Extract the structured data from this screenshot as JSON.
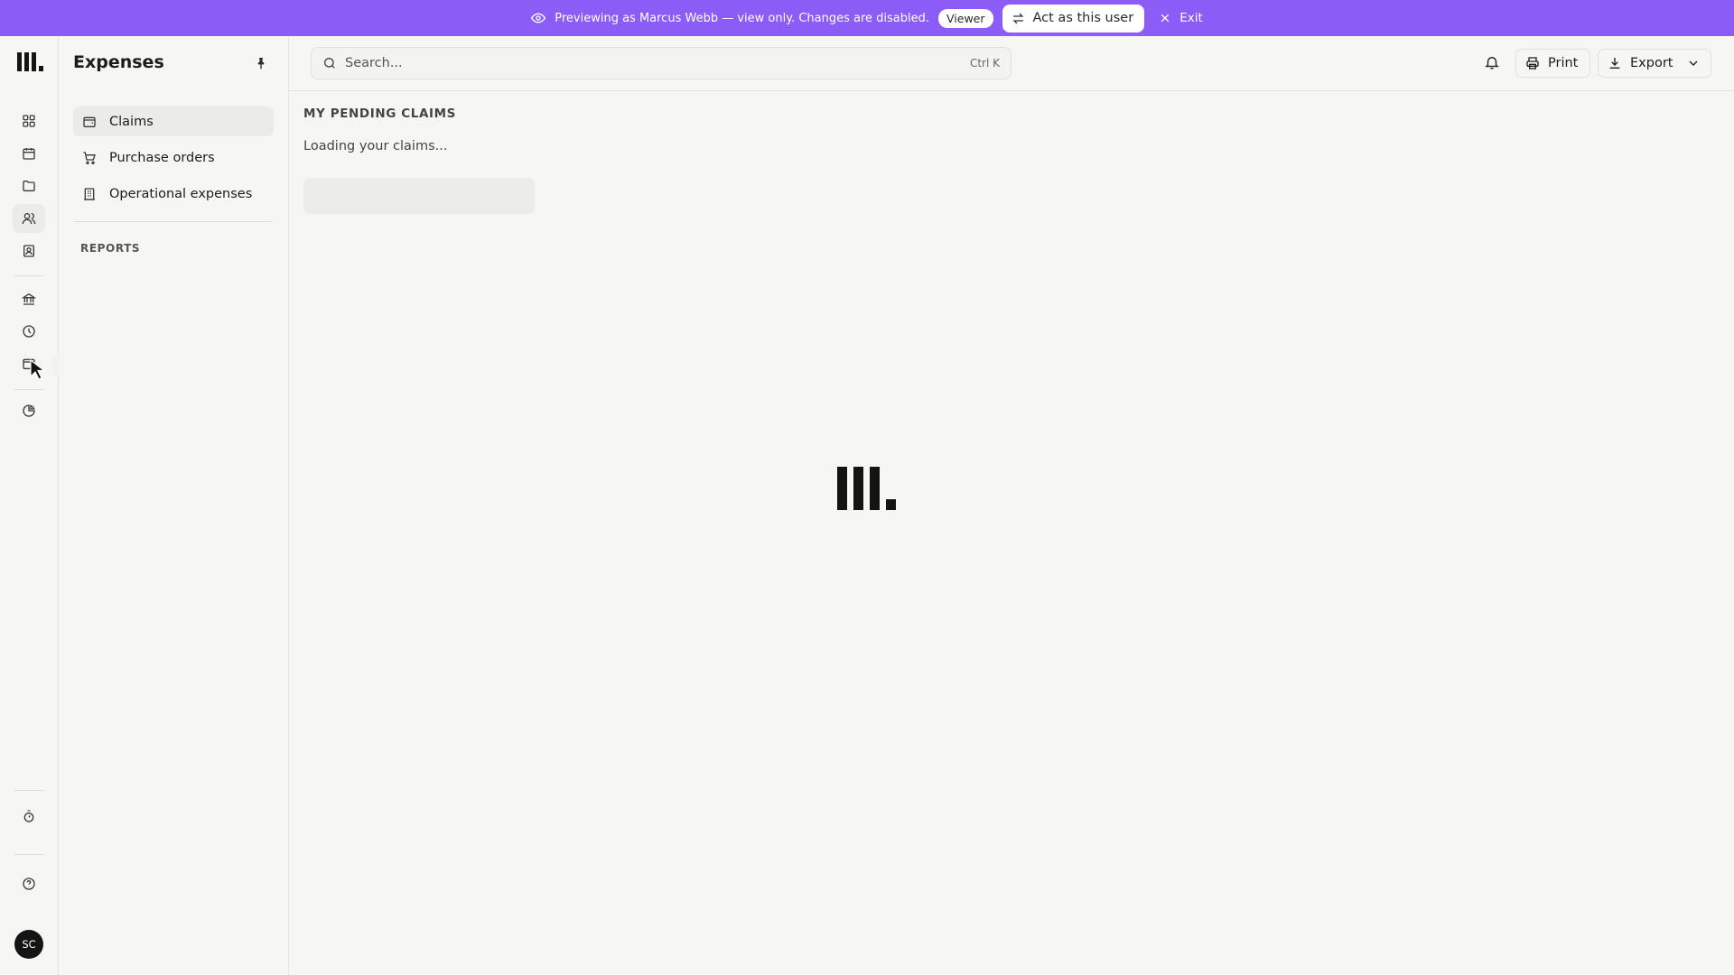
{
  "banner": {
    "message": "Previewing as Marcus Webb — view only. Changes are disabled.",
    "role_badge": "Viewer",
    "act_label": "Act as this user",
    "exit_label": "Exit",
    "background": "#8b5cf6"
  },
  "rail": {
    "icons": [
      "dashboard-icon",
      "calendar-icon",
      "folder-icon",
      "people-icon",
      "contacts-icon",
      "bank-icon",
      "clock-icon",
      "expenses-icon",
      "pie-chart-icon",
      "timer-icon",
      "help-icon"
    ],
    "active": "people-icon",
    "avatar_initials": "SC"
  },
  "sidebar": {
    "title": "Expenses",
    "items": [
      {
        "label": "Claims",
        "icon": "wallet-icon",
        "active": true
      },
      {
        "label": "Purchase orders",
        "icon": "cart-icon",
        "active": false
      },
      {
        "label": "Operational expenses",
        "icon": "building-icon",
        "active": false
      }
    ],
    "section_label": "REPORTS"
  },
  "topbar": {
    "search_placeholder": "Search...",
    "search_shortcut": "Ctrl K",
    "print_label": "Print",
    "export_label": "Export"
  },
  "main": {
    "heading": "MY PENDING CLAIMS",
    "loading_text": "Loading your claims..."
  }
}
